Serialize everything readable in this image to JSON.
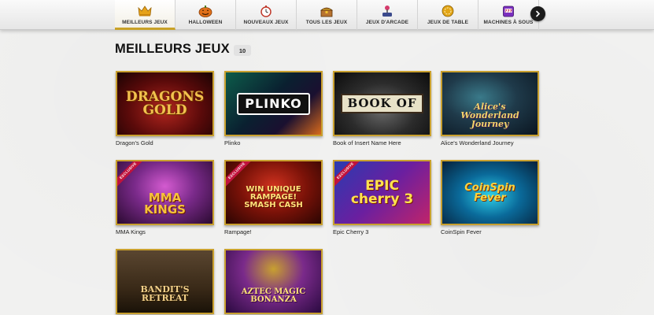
{
  "nav": {
    "tabs": [
      {
        "label": "MEILLEURS JEUX",
        "icon": "crown-icon",
        "active": true
      },
      {
        "label": "HALLOWEEN",
        "icon": "pumpkin-icon",
        "active": false
      },
      {
        "label": "NOUVEAUX JEUX",
        "icon": "stopwatch-icon",
        "active": false
      },
      {
        "label": "TOUS LES JEUX",
        "icon": "treasure-chest-icon",
        "active": false
      },
      {
        "label": "JEUX D'ARCADE",
        "icon": "joystick-icon",
        "active": false
      },
      {
        "label": "JEUX DE TABLE",
        "icon": "chip-icon",
        "active": false
      },
      {
        "label": "MACHINES À SOUS",
        "icon": "slot-machine-icon",
        "active": false
      }
    ],
    "next_icon": "chevron-right-icon"
  },
  "section": {
    "title": "MEILLEURS JEUX",
    "count": "10"
  },
  "games": [
    {
      "name": "Dragon's Gold",
      "logo": "DRAGONS GOLD",
      "exclusive": false
    },
    {
      "name": "Plinko",
      "logo": "PLINKO",
      "exclusive": false
    },
    {
      "name": "Book of Insert Name Here",
      "logo": "BOOK OF",
      "exclusive": false
    },
    {
      "name": "Alice's Wonderland Journey",
      "logo": "Alice's Wonderland Journey",
      "exclusive": false
    },
    {
      "name": "MMA Kings",
      "logo": "MMA KINGS",
      "exclusive": true
    },
    {
      "name": "Rampage!",
      "logo": "WIN UNIQUE RAMPAGE! SMASH CASH",
      "exclusive": true
    },
    {
      "name": "Epic Cherry 3",
      "logo": "EPIC cherry 3",
      "exclusive": true
    },
    {
      "name": "CoinSpin Fever",
      "logo": "CoinSpin Fever",
      "exclusive": false
    },
    {
      "name": "Bandit's Retreat",
      "logo": "BANDIT'S RETREAT",
      "exclusive": false
    },
    {
      "name": "Aztec Magic Bonanza",
      "logo": "AZTEC MAGIC BONANZA",
      "exclusive": false
    }
  ],
  "badges": {
    "exclusive": "EXCLUSIVE"
  },
  "colors": {
    "accent_gold": "#c9a02e",
    "exclusive_red": "#c0123c"
  }
}
